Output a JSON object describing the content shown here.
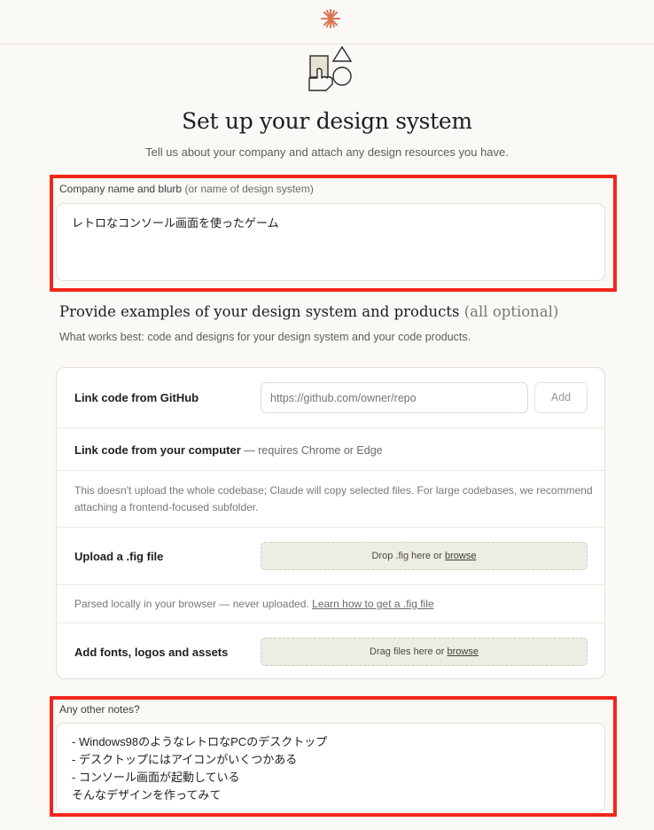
{
  "header": {
    "logo": "claude-star-icon"
  },
  "hero": {
    "icon": "shapes-icon"
  },
  "page": {
    "title": "Set up your design system",
    "subtitle": "Tell us about your company and attach any design resources you have."
  },
  "company": {
    "label": "Company name and blurb",
    "label_hint": "(or name of design system)",
    "value": "レトロなコンソール画面を使ったゲーム"
  },
  "examples": {
    "heading": "Provide examples of your design system and products",
    "heading_hint": "(all optional)",
    "subtitle": "What works best: code and designs for your design system and your code products."
  },
  "github": {
    "label": "Link code from GitHub",
    "placeholder": "https://github.com/owner/repo",
    "add_label": "Add"
  },
  "local_code": {
    "label": "Link code from your computer",
    "requirement": " — requires Chrome or Edge",
    "note": "This doesn't upload the whole codebase; Claude will copy selected files. For large codebases, we recommend attaching a frontend-focused subfolder."
  },
  "fig": {
    "label": "Upload a .fig file",
    "drop_text": "Drop .fig here or ",
    "browse": "browse",
    "note": "Parsed locally in your browser — never uploaded. ",
    "learn_link": "Learn how to get a .fig file"
  },
  "assets": {
    "label": "Add fonts, logos and assets",
    "drop_text": "Drag files here or ",
    "browse": "browse"
  },
  "notes": {
    "label": "Any other notes?",
    "value": "- Windows98のようなレトロなPCのデスクトップ\n- デスクトップにはアイコンがいくつかある\n- コンソール画面が起動している\nそんなデザインを作ってみて"
  },
  "colors": {
    "highlight": "#f2261b",
    "accent": "#d97757"
  }
}
